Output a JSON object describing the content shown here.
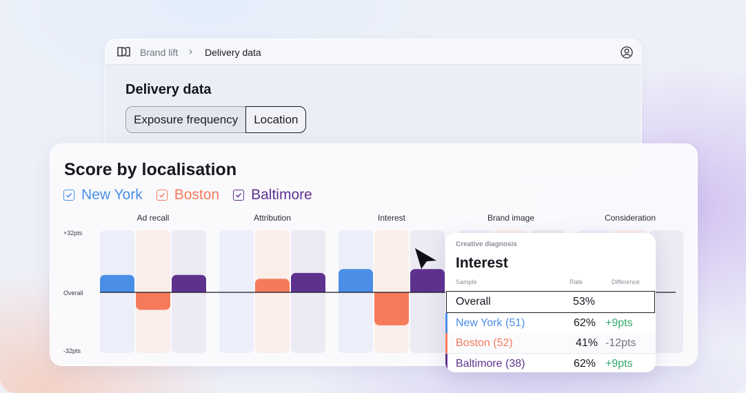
{
  "breadcrumb": {
    "parent": "Brand lift",
    "separator": "›",
    "current": "Delivery data"
  },
  "page": {
    "title": "Delivery data"
  },
  "segments": [
    {
      "label": "Exposure frequency",
      "active": false
    },
    {
      "label": "Location",
      "active": true
    }
  ],
  "card": {
    "title": "Score by localisation",
    "legend": [
      {
        "label": "New York",
        "color": "#4a8ee8",
        "checked": true
      },
      {
        "label": "Boston",
        "color": "#f57a5a",
        "checked": true
      },
      {
        "label": "Baltimore",
        "color": "#5e318f",
        "checked": true
      }
    ]
  },
  "chart_data": {
    "type": "bar",
    "categories": [
      "Ad recall",
      "Attribution",
      "Interest",
      "Brand image",
      "Consideration"
    ],
    "y_tick_labels": [
      "+32pts",
      "Overall",
      "-32pts"
    ],
    "ylim": [
      -32,
      32
    ],
    "series": [
      {
        "name": "New York",
        "color": "#4a8ee8",
        "values": [
          9,
          0,
          12,
          null,
          null
        ]
      },
      {
        "name": "Boston",
        "color": "#f57a5a",
        "values": [
          -9,
          7,
          -17,
          null,
          null
        ]
      },
      {
        "name": "Baltimore",
        "color": "#5e318f",
        "values": [
          9,
          10,
          12,
          null,
          null
        ]
      }
    ]
  },
  "popup": {
    "subtitle": "Creative diagnosis",
    "title": "Interest",
    "headers": {
      "sample": "Sample",
      "rate": "Rate",
      "difference": "Difference"
    },
    "overall": {
      "name": "Overall",
      "rate": "53%"
    },
    "rows": [
      {
        "name": "New York (51)",
        "rate": "62%",
        "diff": "+9pts",
        "color": "#4a8ee8",
        "diff_color": "#2faa6a"
      },
      {
        "name": "Boston (52)",
        "rate": "41%",
        "diff": "-12pts",
        "color": "#f57a5a",
        "diff_color": "#70737f"
      },
      {
        "name": "Baltimore (38)",
        "rate": "62%",
        "diff": "+9pts",
        "color": "#5e318f",
        "diff_color": "#2faa6a"
      }
    ]
  },
  "icons": {
    "logo": "brand-logo-icon",
    "avatar": "user-avatar-icon",
    "cursor": "pointer-cursor-icon"
  }
}
